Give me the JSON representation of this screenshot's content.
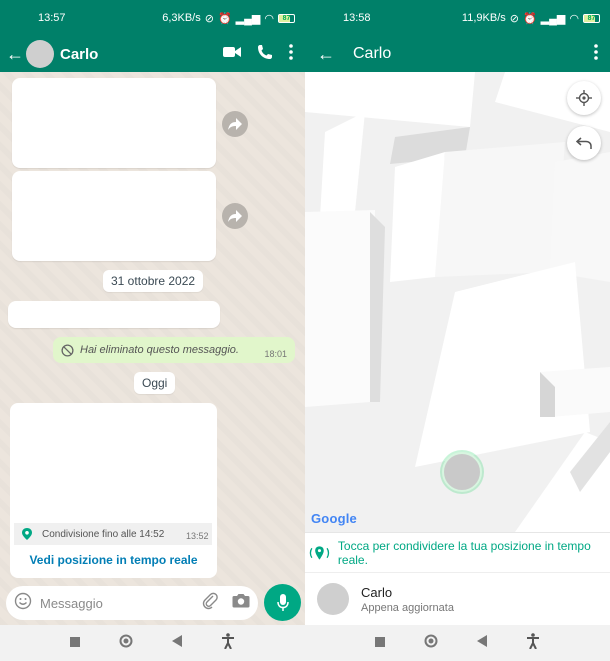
{
  "left": {
    "status": {
      "time": "13:57",
      "speed": "6,3KB/s",
      "battery": "87"
    },
    "header": {
      "contact_name": "Carlo"
    },
    "date_chip_1": "31 ottobre 2022",
    "deleted": {
      "text": "Hai eliminato questo messaggio.",
      "time": "18:01"
    },
    "date_chip_2": "Oggi",
    "location": {
      "sharing_text": "Condivisione fino alle 14:52",
      "time": "13:52",
      "link": "Vedi posizione in tempo reale"
    },
    "input": {
      "placeholder": "Messaggio"
    }
  },
  "right": {
    "status": {
      "time": "13:58",
      "speed": "11,9KB/s",
      "battery": "87"
    },
    "header": {
      "contact_name": "Carlo"
    },
    "map": {
      "attribution": "Google"
    },
    "share_prompt": "Tocca per condividere la tua posizione in tempo reale.",
    "contact": {
      "name": "Carlo",
      "subtitle": "Appena aggiornata"
    }
  },
  "colors": {
    "header": "#008069",
    "accent": "#00a884",
    "link": "#027eb5",
    "chat_bg": "#ece5dd"
  },
  "icons": [
    "back-arrow-icon",
    "video-call-icon",
    "phone-icon",
    "more-vert-icon",
    "forward-icon",
    "blocked-icon",
    "location-pin-icon",
    "emoji-icon",
    "attach-icon",
    "camera-icon",
    "mic-icon",
    "my-location-icon",
    "undo-icon",
    "live-location-icon"
  ]
}
